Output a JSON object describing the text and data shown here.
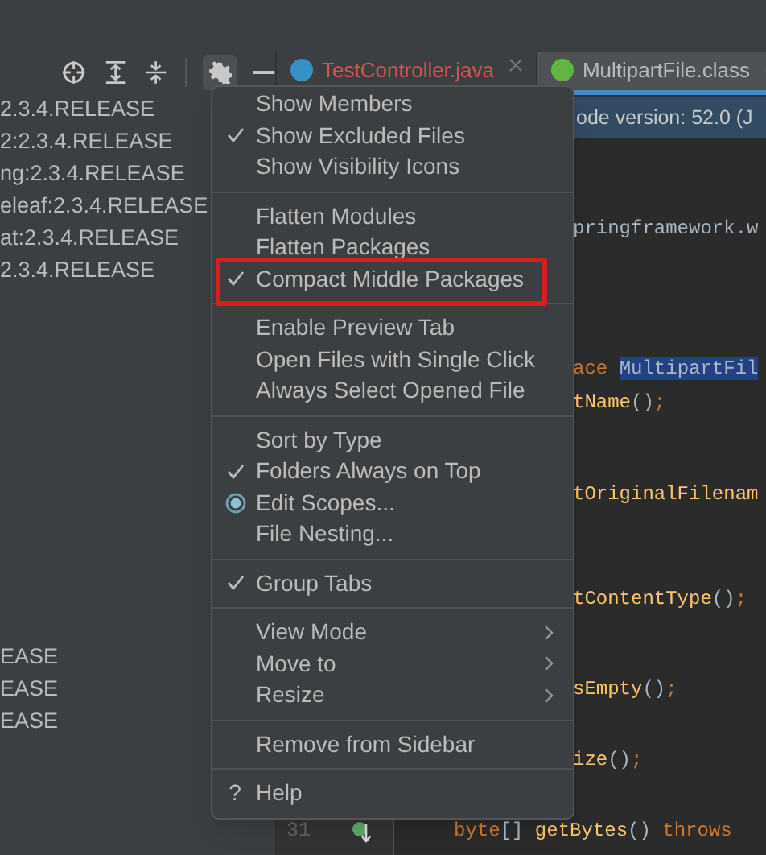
{
  "project_tree": {
    "rows": [
      {
        "text": "2.3.4.RELEASE"
      },
      {
        "text": "2:2.3.4.RELEASE"
      },
      {
        "text": "ng:2.3.4.RELEASE"
      },
      {
        "text": "eleaf:2.3.4.RELEASE"
      },
      {
        "text": "at:2.3.4.RELEASE"
      },
      {
        "text": "2.3.4.RELEASE"
      }
    ],
    "lower_rows": [
      {
        "text": "EASE"
      },
      {
        "text": "EASE"
      },
      {
        "text": "EASE"
      }
    ]
  },
  "editor": {
    "tabs": [
      {
        "label": "TestController.java",
        "selected": false,
        "kind": "class",
        "error": true
      },
      {
        "label": "MultipartFile.class",
        "selected": true,
        "kind": "interface",
        "error": false
      }
    ],
    "banner": "ode version: 52.0 (J",
    "code_lines": [
      [
        {
          "text": "pringframework.w",
          "kind": "plain"
        }
      ],
      [
        {
          "text": "ace ",
          "kind": "keyword"
        },
        {
          "text": "MultipartFil",
          "kind": "highlight"
        }
      ],
      [
        {
          "text": "tName",
          "kind": "method"
        },
        {
          "text": "()",
          "kind": "plain"
        },
        {
          "text": ";",
          "kind": "keyword"
        }
      ],
      [
        {
          "text": "tOriginalFilenam",
          "kind": "method"
        }
      ],
      [
        {
          "text": "tContentType",
          "kind": "method"
        },
        {
          "text": "()",
          "kind": "plain"
        },
        {
          "text": ";",
          "kind": "keyword"
        }
      ],
      [
        {
          "text": "sEmpty",
          "kind": "method"
        },
        {
          "text": "()",
          "kind": "plain"
        },
        {
          "text": ";",
          "kind": "keyword"
        }
      ],
      [
        {
          "text": "ize",
          "kind": "method"
        },
        {
          "text": "()",
          "kind": "plain"
        },
        {
          "text": ";",
          "kind": "keyword"
        }
      ]
    ],
    "last_line": {
      "line_number": "31",
      "tokens": [
        {
          "text": "byte",
          "kind": "keyword"
        },
        {
          "text": "[] ",
          "kind": "plain"
        },
        {
          "text": "getBytes",
          "kind": "method"
        },
        {
          "text": "() ",
          "kind": "plain"
        },
        {
          "text": "throws",
          "kind": "keyword"
        }
      ]
    }
  },
  "menu": {
    "groups": [
      [
        {
          "label": "Show Members",
          "kind": "check",
          "checked": false,
          "boxed": false
        },
        {
          "label": "Show Excluded Files",
          "kind": "check",
          "checked": true,
          "boxed": false
        },
        {
          "label": "Show Visibility Icons",
          "kind": "check",
          "checked": false,
          "boxed": false
        }
      ],
      [
        {
          "label": "Flatten Modules",
          "kind": "check",
          "checked": false,
          "boxed": false
        },
        {
          "label": "Flatten Packages",
          "kind": "check",
          "checked": false,
          "boxed": false
        },
        {
          "label": "Compact Middle Packages",
          "kind": "check",
          "checked": true,
          "boxed": true
        }
      ],
      [
        {
          "label": "Enable Preview Tab",
          "kind": "check",
          "checked": false,
          "boxed": false
        },
        {
          "label": "Open Files with Single Click",
          "kind": "check",
          "checked": false,
          "boxed": false
        },
        {
          "label": "Always Select Opened File",
          "kind": "check",
          "checked": false,
          "boxed": false
        }
      ],
      [
        {
          "label": "Sort by Type",
          "kind": "check",
          "checked": false,
          "boxed": false
        },
        {
          "label": "Folders Always on Top",
          "kind": "check",
          "checked": true,
          "boxed": false
        },
        {
          "label": "Edit Scopes...",
          "kind": "radio",
          "selected": true,
          "boxed": false
        },
        {
          "label": "File Nesting...",
          "kind": "action",
          "boxed": false
        }
      ],
      [
        {
          "label": "Group Tabs",
          "kind": "check",
          "checked": true,
          "boxed": false
        }
      ],
      [
        {
          "label": "View Mode",
          "kind": "submenu",
          "boxed": false
        },
        {
          "label": "Move to",
          "kind": "submenu",
          "boxed": false
        },
        {
          "label": "Resize",
          "kind": "submenu",
          "boxed": false
        }
      ],
      [
        {
          "label": "Remove from Sidebar",
          "kind": "action",
          "boxed": false
        }
      ],
      [
        {
          "label": "Help",
          "kind": "help",
          "glyph": "?",
          "boxed": false
        }
      ]
    ]
  }
}
